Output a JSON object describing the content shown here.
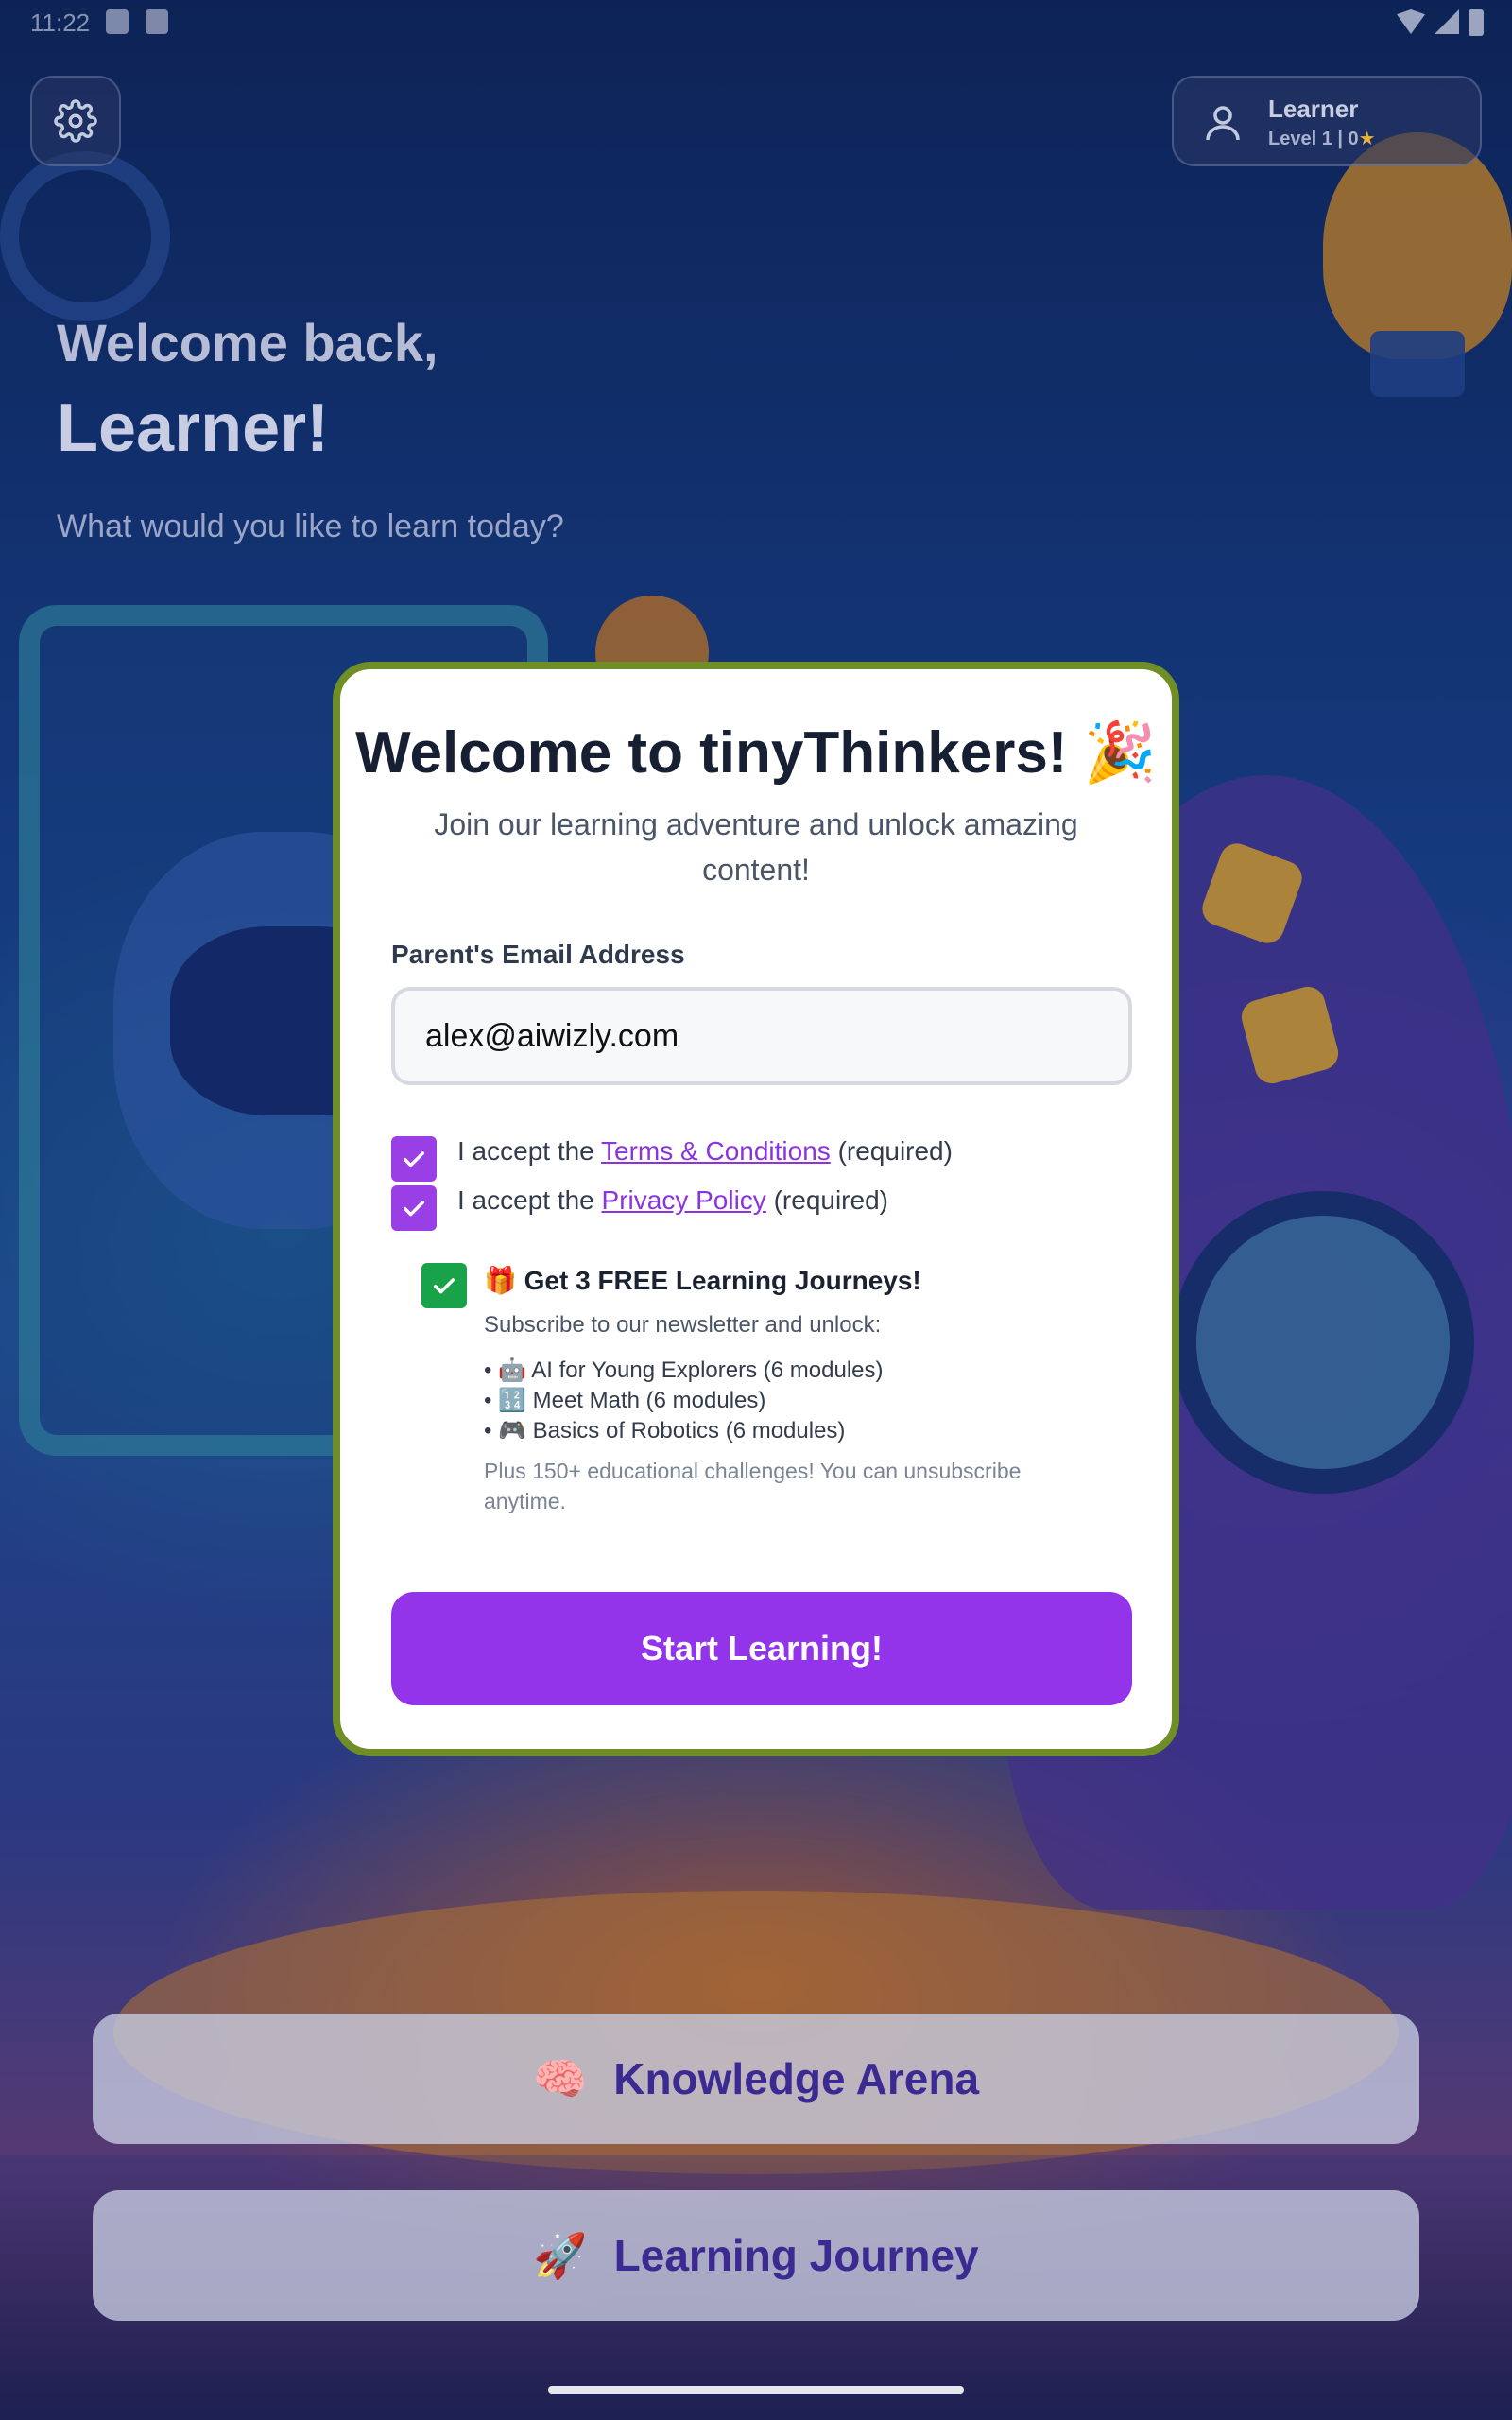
{
  "status_bar": {
    "time": "11:22"
  },
  "profile": {
    "name": "Learner",
    "level": "Level 1 | 0",
    "level_icon": "star-icon"
  },
  "greeting": {
    "line1": "Welcome back,",
    "line2": "Learner!",
    "prompt": "What would you like to learn today?"
  },
  "modal": {
    "title": "Welcome to tinyThinkers! 🎉",
    "subtitle": "Join our learning adventure and unlock amazing content!",
    "email_label": "Parent's Email Address",
    "email_value": "alex@aiwizly.com",
    "terms": {
      "prefix": "I accept the ",
      "link": "Terms & Conditions",
      "suffix": " (required)",
      "checked": true
    },
    "privacy": {
      "prefix": "I accept the ",
      "link": "Privacy Policy",
      "suffix": " (required)",
      "checked": true
    },
    "newsletter": {
      "checked": true,
      "title": "🎁 Get 3 FREE Learning Journeys!",
      "subtitle": "Subscribe to our newsletter and unlock:",
      "items": [
        "• 🤖 AI for Young Explorers (6 modules)",
        "• 🔢 Meet Math (6 modules)",
        "• 🎮 Basics of Robotics (6 modules)"
      ],
      "note": "Plus 150+ educational challenges! You can unsubscribe anytime."
    },
    "cta": "Start Learning!"
  },
  "buttons": {
    "knowledge_arena": {
      "emoji": "🧠",
      "label": "Knowledge Arena"
    },
    "learning_journey": {
      "emoji": "🚀",
      "label": "Learning Journey"
    }
  },
  "colors": {
    "accent_purple": "#9333ea",
    "check_purple": "#9a3ee6",
    "check_green": "#18a24a",
    "modal_border": "#6f8f26",
    "button_text": "#3a2a92"
  }
}
